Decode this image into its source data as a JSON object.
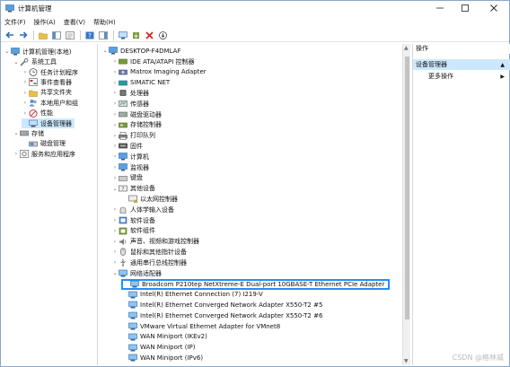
{
  "window": {
    "title": "计算机管理"
  },
  "menu": [
    "文件(F)",
    "操作(A)",
    "查看(V)",
    "帮助(H)"
  ],
  "left_tree": [
    {
      "label": "计算机管理(本地)",
      "depth": 0,
      "expander": "v",
      "icon": "computer-management-icon"
    },
    {
      "label": "系统工具",
      "depth": 1,
      "expander": "v",
      "icon": "tools-icon"
    },
    {
      "label": "任务计划程序",
      "depth": 2,
      "expander": ">",
      "icon": "clock-icon"
    },
    {
      "label": "事件查看器",
      "depth": 2,
      "expander": ">",
      "icon": "event-viewer-icon"
    },
    {
      "label": "共享文件夹",
      "depth": 2,
      "expander": ">",
      "icon": "shared-folder-icon"
    },
    {
      "label": "本地用户和组",
      "depth": 2,
      "expander": ">",
      "icon": "users-icon"
    },
    {
      "label": "性能",
      "depth": 2,
      "expander": ">",
      "icon": "performance-icon"
    },
    {
      "label": "设备管理器",
      "depth": 2,
      "expander": "",
      "icon": "device-manager-icon",
      "selected": true
    },
    {
      "label": "存储",
      "depth": 1,
      "expander": "v",
      "icon": "storage-icon"
    },
    {
      "label": "磁盘管理",
      "depth": 2,
      "expander": "",
      "icon": "disk-icon"
    },
    {
      "label": "服务和应用程序",
      "depth": 1,
      "expander": ">",
      "icon": "services-icon"
    }
  ],
  "device_tree": [
    {
      "label": "DESKTOP-F4DMLAF",
      "depth": 0,
      "expander": "v",
      "icon": "computer-icon"
    },
    {
      "label": "IDE ATA/ATAPI 控制器",
      "depth": 1,
      "expander": ">",
      "icon": "ide-controller-icon"
    },
    {
      "label": "Matrox Imaging Adapter",
      "depth": 1,
      "expander": ">",
      "icon": "imaging-adapter-icon"
    },
    {
      "label": "SIMATIC NET",
      "depth": 1,
      "expander": ">",
      "icon": "simatic-net-icon"
    },
    {
      "label": "处理器",
      "depth": 1,
      "expander": ">",
      "icon": "processor-icon"
    },
    {
      "label": "传感器",
      "depth": 1,
      "expander": ">",
      "icon": "sensor-icon"
    },
    {
      "label": "磁盘驱动器",
      "depth": 1,
      "expander": ">",
      "icon": "disk-drive-icon"
    },
    {
      "label": "存储控制器",
      "depth": 1,
      "expander": ">",
      "icon": "storage-controller-icon"
    },
    {
      "label": "打印队列",
      "depth": 1,
      "expander": ">",
      "icon": "printer-icon"
    },
    {
      "label": "固件",
      "depth": 1,
      "expander": ">",
      "icon": "firmware-icon"
    },
    {
      "label": "计算机",
      "depth": 1,
      "expander": ">",
      "icon": "computer-icon"
    },
    {
      "label": "监视器",
      "depth": 1,
      "expander": ">",
      "icon": "monitor-icon"
    },
    {
      "label": "键盘",
      "depth": 1,
      "expander": ">",
      "icon": "keyboard-icon"
    },
    {
      "label": "其他设备",
      "depth": 1,
      "expander": "v",
      "icon": "other-devices-icon"
    },
    {
      "label": "以太网控制器",
      "depth": 2,
      "expander": "",
      "icon": "warning-device-icon"
    },
    {
      "label": "人体学输入设备",
      "depth": 1,
      "expander": ">",
      "icon": "hid-icon"
    },
    {
      "label": "软件设备",
      "depth": 1,
      "expander": ">",
      "icon": "software-device-icon"
    },
    {
      "label": "软件组件",
      "depth": 1,
      "expander": ">",
      "icon": "software-component-icon"
    },
    {
      "label": "声音、视频和游戏控制器",
      "depth": 1,
      "expander": ">",
      "icon": "sound-icon"
    },
    {
      "label": "鼠标和其他指针设备",
      "depth": 1,
      "expander": ">",
      "icon": "mouse-icon"
    },
    {
      "label": "通用串行总线控制器",
      "depth": 1,
      "expander": ">",
      "icon": "usb-icon"
    },
    {
      "label": "网络适配器",
      "depth": 1,
      "expander": "v",
      "icon": "network-adapter-icon"
    },
    {
      "label": "Broadcom P210tep NetXtreme-E Dual-port 10GBASE-T Ethernet PCIe Adapter",
      "depth": 2,
      "expander": "",
      "icon": "network-adapter-icon",
      "highlighted": true
    },
    {
      "label": "Intel(R) Ethernet Connection (7) I219-V",
      "depth": 2,
      "expander": "",
      "icon": "network-adapter-icon"
    },
    {
      "label": "Intel(R) Ethernet Converged Network Adapter X550-T2 #5",
      "depth": 2,
      "expander": "",
      "icon": "network-adapter-icon"
    },
    {
      "label": "Intel(R) Ethernet Converged Network Adapter X550-T2 #6",
      "depth": 2,
      "expander": "",
      "icon": "network-adapter-icon"
    },
    {
      "label": "VMware Virtual Ethernet Adapter for VMnet8",
      "depth": 2,
      "expander": "",
      "icon": "network-adapter-icon"
    },
    {
      "label": "WAN Miniport (IKEv2)",
      "depth": 2,
      "expander": "",
      "icon": "network-adapter-icon"
    },
    {
      "label": "WAN Miniport (IP)",
      "depth": 2,
      "expander": "",
      "icon": "network-adapter-icon"
    },
    {
      "label": "WAN Miniport (IPv6)",
      "depth": 2,
      "expander": "",
      "icon": "network-adapter-icon"
    }
  ],
  "actions": {
    "header": "操作",
    "section": "设备管理器",
    "more": "更多操作"
  },
  "watermark": "CSDN @格林威",
  "colors": {
    "selection": "#cce8ff",
    "highlight_border": "#1e90ff"
  }
}
